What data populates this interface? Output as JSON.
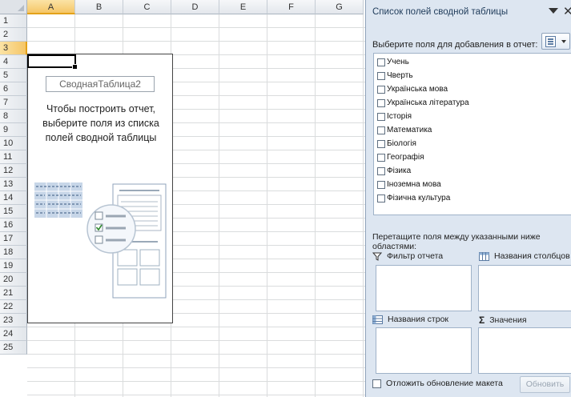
{
  "sheet": {
    "columns": [
      "A",
      "B",
      "C",
      "D",
      "E",
      "F",
      "G"
    ],
    "rows": [
      "1",
      "2",
      "3",
      "4",
      "5",
      "6",
      "7",
      "8",
      "9",
      "10",
      "11",
      "12",
      "13",
      "14",
      "15",
      "16",
      "17",
      "18",
      "19",
      "20",
      "21",
      "22",
      "23",
      "24",
      "25"
    ],
    "selected_column": "A",
    "selected_row": "3"
  },
  "pivot_placeholder": {
    "name": "СводнаяТаблица2",
    "message_lines": [
      "Чтобы построить отчет,",
      "выберите поля из списка",
      "полей сводной таблицы"
    ]
  },
  "pane": {
    "title": "Список полей сводной таблицы",
    "choose_label": "Выберите поля для добавления в отчет:",
    "fields": [
      "Учень",
      "Чверть",
      "Українська мова",
      "Українська література",
      "Історія",
      "Математика",
      "Біологія",
      "Географія",
      "Фізика",
      "Іноземна мова",
      "Фізична культура"
    ],
    "drag_label": "Перетащите поля между указанными ниже областями:",
    "areas": {
      "report_filter": "Фильтр отчета",
      "column_labels": "Названия столбцов",
      "row_labels": "Названия строк",
      "values": "Значения"
    },
    "defer_label": "Отложить обновление макета",
    "update_button": "Обновить"
  },
  "icons": {
    "pane_menu": "dropdown-triangle-icon",
    "pane_close": "close-icon",
    "layout": "field-layout-icon",
    "filter": "filter-funnel-icon",
    "columns": "column-labels-icon",
    "rows": "row-labels-icon",
    "values": "sigma-icon"
  },
  "colors": {
    "pane_bg": "#dde6f1",
    "selected_header": "#f5c667"
  }
}
